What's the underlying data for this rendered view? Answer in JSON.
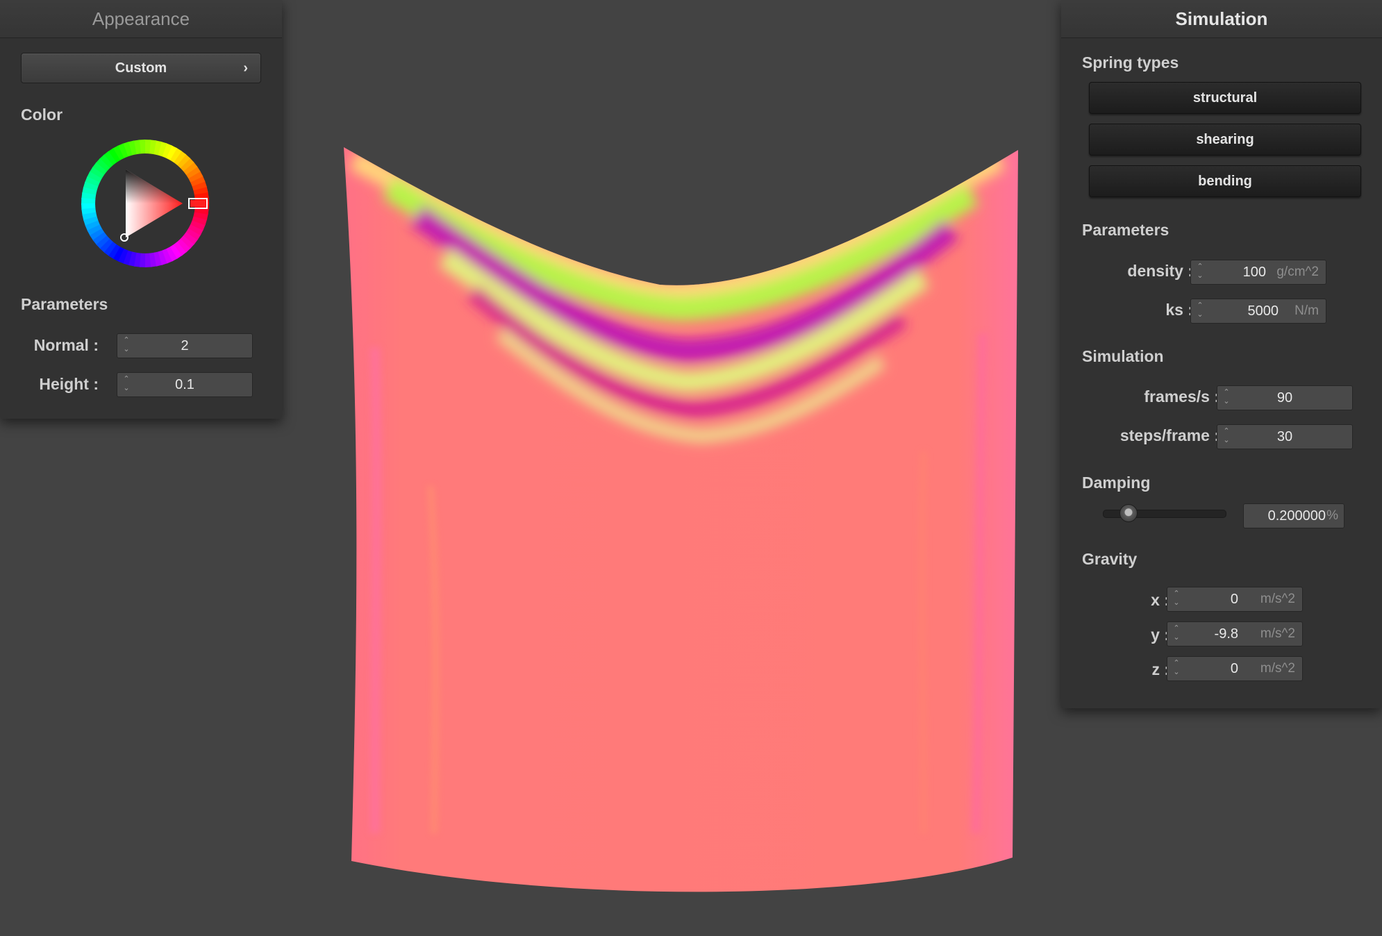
{
  "appearance": {
    "title": "Appearance",
    "preset": "Custom",
    "preset_chevron": "›",
    "color_section": "Color",
    "params_section": "Parameters",
    "normal": {
      "label": "Normal :",
      "value": "2"
    },
    "height": {
      "label": "Height :",
      "value": "0.1"
    },
    "color": "#ff2020"
  },
  "simulation": {
    "title": "Simulation",
    "spring_section": "Spring types",
    "springs": [
      "structural",
      "shearing",
      "bending"
    ],
    "params_section": "Parameters",
    "density": {
      "label": "density :",
      "value": "100",
      "unit": "g/cm^2"
    },
    "ks": {
      "label": "ks :",
      "value": "5000",
      "unit": "N/m"
    },
    "sim_section": "Simulation",
    "fps": {
      "label": "frames/s :",
      "value": "90"
    },
    "steps": {
      "label": "steps/frame :",
      "value": "30"
    },
    "damping_section": "Damping",
    "damping": {
      "value": "0.200000",
      "unit": "%",
      "fraction": 0.2
    },
    "gravity_section": "Gravity",
    "gx": {
      "label": "x :",
      "value": "0",
      "unit": "m/s^2"
    },
    "gy": {
      "label": "y :",
      "value": "-9.8",
      "unit": "m/s^2"
    },
    "gz": {
      "label": "z :",
      "value": "0",
      "unit": "m/s^2"
    }
  },
  "viewport": {
    "background": "#434343",
    "cloth_color": "#ff7a78",
    "fold_colors": [
      "#b8f34a",
      "#c21fb0",
      "#e3ee7e"
    ]
  }
}
